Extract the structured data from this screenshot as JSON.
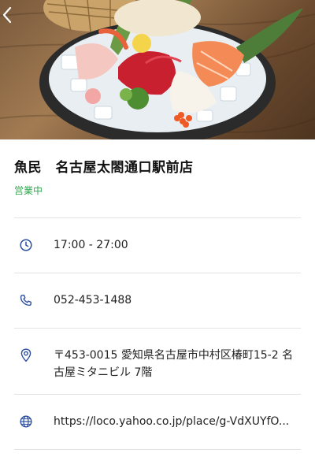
{
  "hero": {
    "image_alt": "",
    "back_icon": "chevron-left-icon"
  },
  "shop": {
    "name": "魚民　名古屋太閤通口駅前店",
    "status": "営業中"
  },
  "colors": {
    "status_open": "#2fa84f",
    "icon_blue": "#2c4fa0",
    "divider": "#e3e3e3"
  },
  "info": {
    "hours": {
      "icon": "clock-icon",
      "text": "17:00 - 27:00"
    },
    "phone": {
      "icon": "phone-icon",
      "text": "052-453-1488"
    },
    "address": {
      "icon": "location-pin-icon",
      "text": "〒453-0015 愛知県名古屋市中村区椿町15-2 名古屋ミタニビル 7階"
    },
    "website": {
      "icon": "globe-icon",
      "text": "https://loco.yahoo.co.jp/place/g-VdXUYfO..."
    }
  }
}
